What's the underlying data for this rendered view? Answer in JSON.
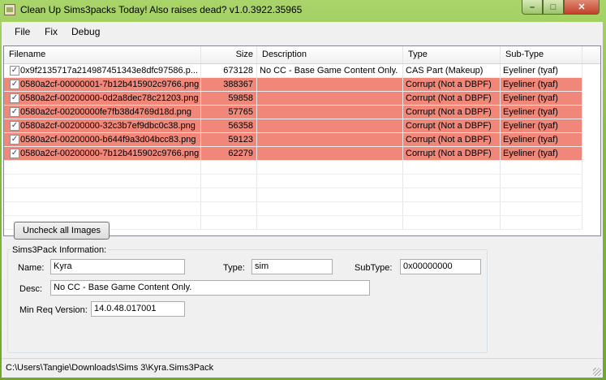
{
  "window": {
    "title": "Clean Up Sims3packs Today! Also raises dead? v1.0.3922.35965"
  },
  "controls": {
    "minimize": "–",
    "maximize": "□",
    "close": "✕"
  },
  "menu": {
    "items": [
      "File",
      "Fix",
      "Debug"
    ]
  },
  "grid": {
    "columns": [
      "Filename",
      "Size",
      "Description",
      "Type",
      "Sub-Type"
    ],
    "rows": [
      {
        "checked": "✓",
        "filename": "0x9f2135717a214987451343e8dfc97586.p...",
        "size": "673128",
        "description": "No CC - Base Game Content Only.",
        "type": "CAS Part (Makeup)",
        "subtype": "Eyeliner (tyaf)",
        "highlight": false
      },
      {
        "checked": "✓",
        "filename": "0580a2cf-00000001-7b12b415902c9766.png",
        "size": "388367",
        "description": "",
        "type": "Corrupt (Not a DBPF)",
        "subtype": "Eyeliner (tyaf)",
        "highlight": true
      },
      {
        "checked": "✓",
        "filename": "0580a2cf-00200000-0d2a8dec78c21203.png",
        "size": "59858",
        "description": "",
        "type": "Corrupt (Not a DBPF)",
        "subtype": "Eyeliner (tyaf)",
        "highlight": true
      },
      {
        "checked": "✓",
        "filename": "0580a2cf-00200000fe7fb38d4769d18d.png",
        "size": "57765",
        "description": "",
        "type": "Corrupt (Not a DBPF)",
        "subtype": "Eyeliner (tyaf)",
        "highlight": true
      },
      {
        "checked": "✓",
        "filename": "0580a2cf-00200000-32c3b7ef9dbc0c38.png",
        "size": "56358",
        "description": "",
        "type": "Corrupt (Not a DBPF)",
        "subtype": "Eyeliner (tyaf)",
        "highlight": true
      },
      {
        "checked": "✓",
        "filename": "0580a2cf-00200000-b644f9a3d04bcc83.png",
        "size": "59123",
        "description": "",
        "type": "Corrupt (Not a DBPF)",
        "subtype": "Eyeliner (tyaf)",
        "highlight": true
      },
      {
        "checked": "✓",
        "filename": "0580a2cf-00200000-7b12b415902c9766.png",
        "size": "62279",
        "description": "",
        "type": "Corrupt (Not a DBPF)",
        "subtype": "Eyeliner (tyaf)",
        "highlight": true
      }
    ],
    "highlight_color": "#f08778"
  },
  "actions": {
    "uncheck_label": "Uncheck all Images"
  },
  "info": {
    "title": "Sims3Pack Information:",
    "name_label": "Name:",
    "name_value": "Kyra",
    "type_label": "Type:",
    "type_value": "sim",
    "subtype_label": "SubType:",
    "subtype_value": "0x00000000",
    "desc_label": "Desc:",
    "desc_value": "No CC - Base Game Content Only.",
    "minreq_label": "Min Req Version:",
    "minreq_value": "14.0.48.017001"
  },
  "status": {
    "path": "C:\\Users\\Tangie\\Downloads\\Sims 3\\Kyra.Sims3Pack"
  },
  "colors": {
    "window_frame": "#84bb3f",
    "close_button": "#c2402a"
  }
}
